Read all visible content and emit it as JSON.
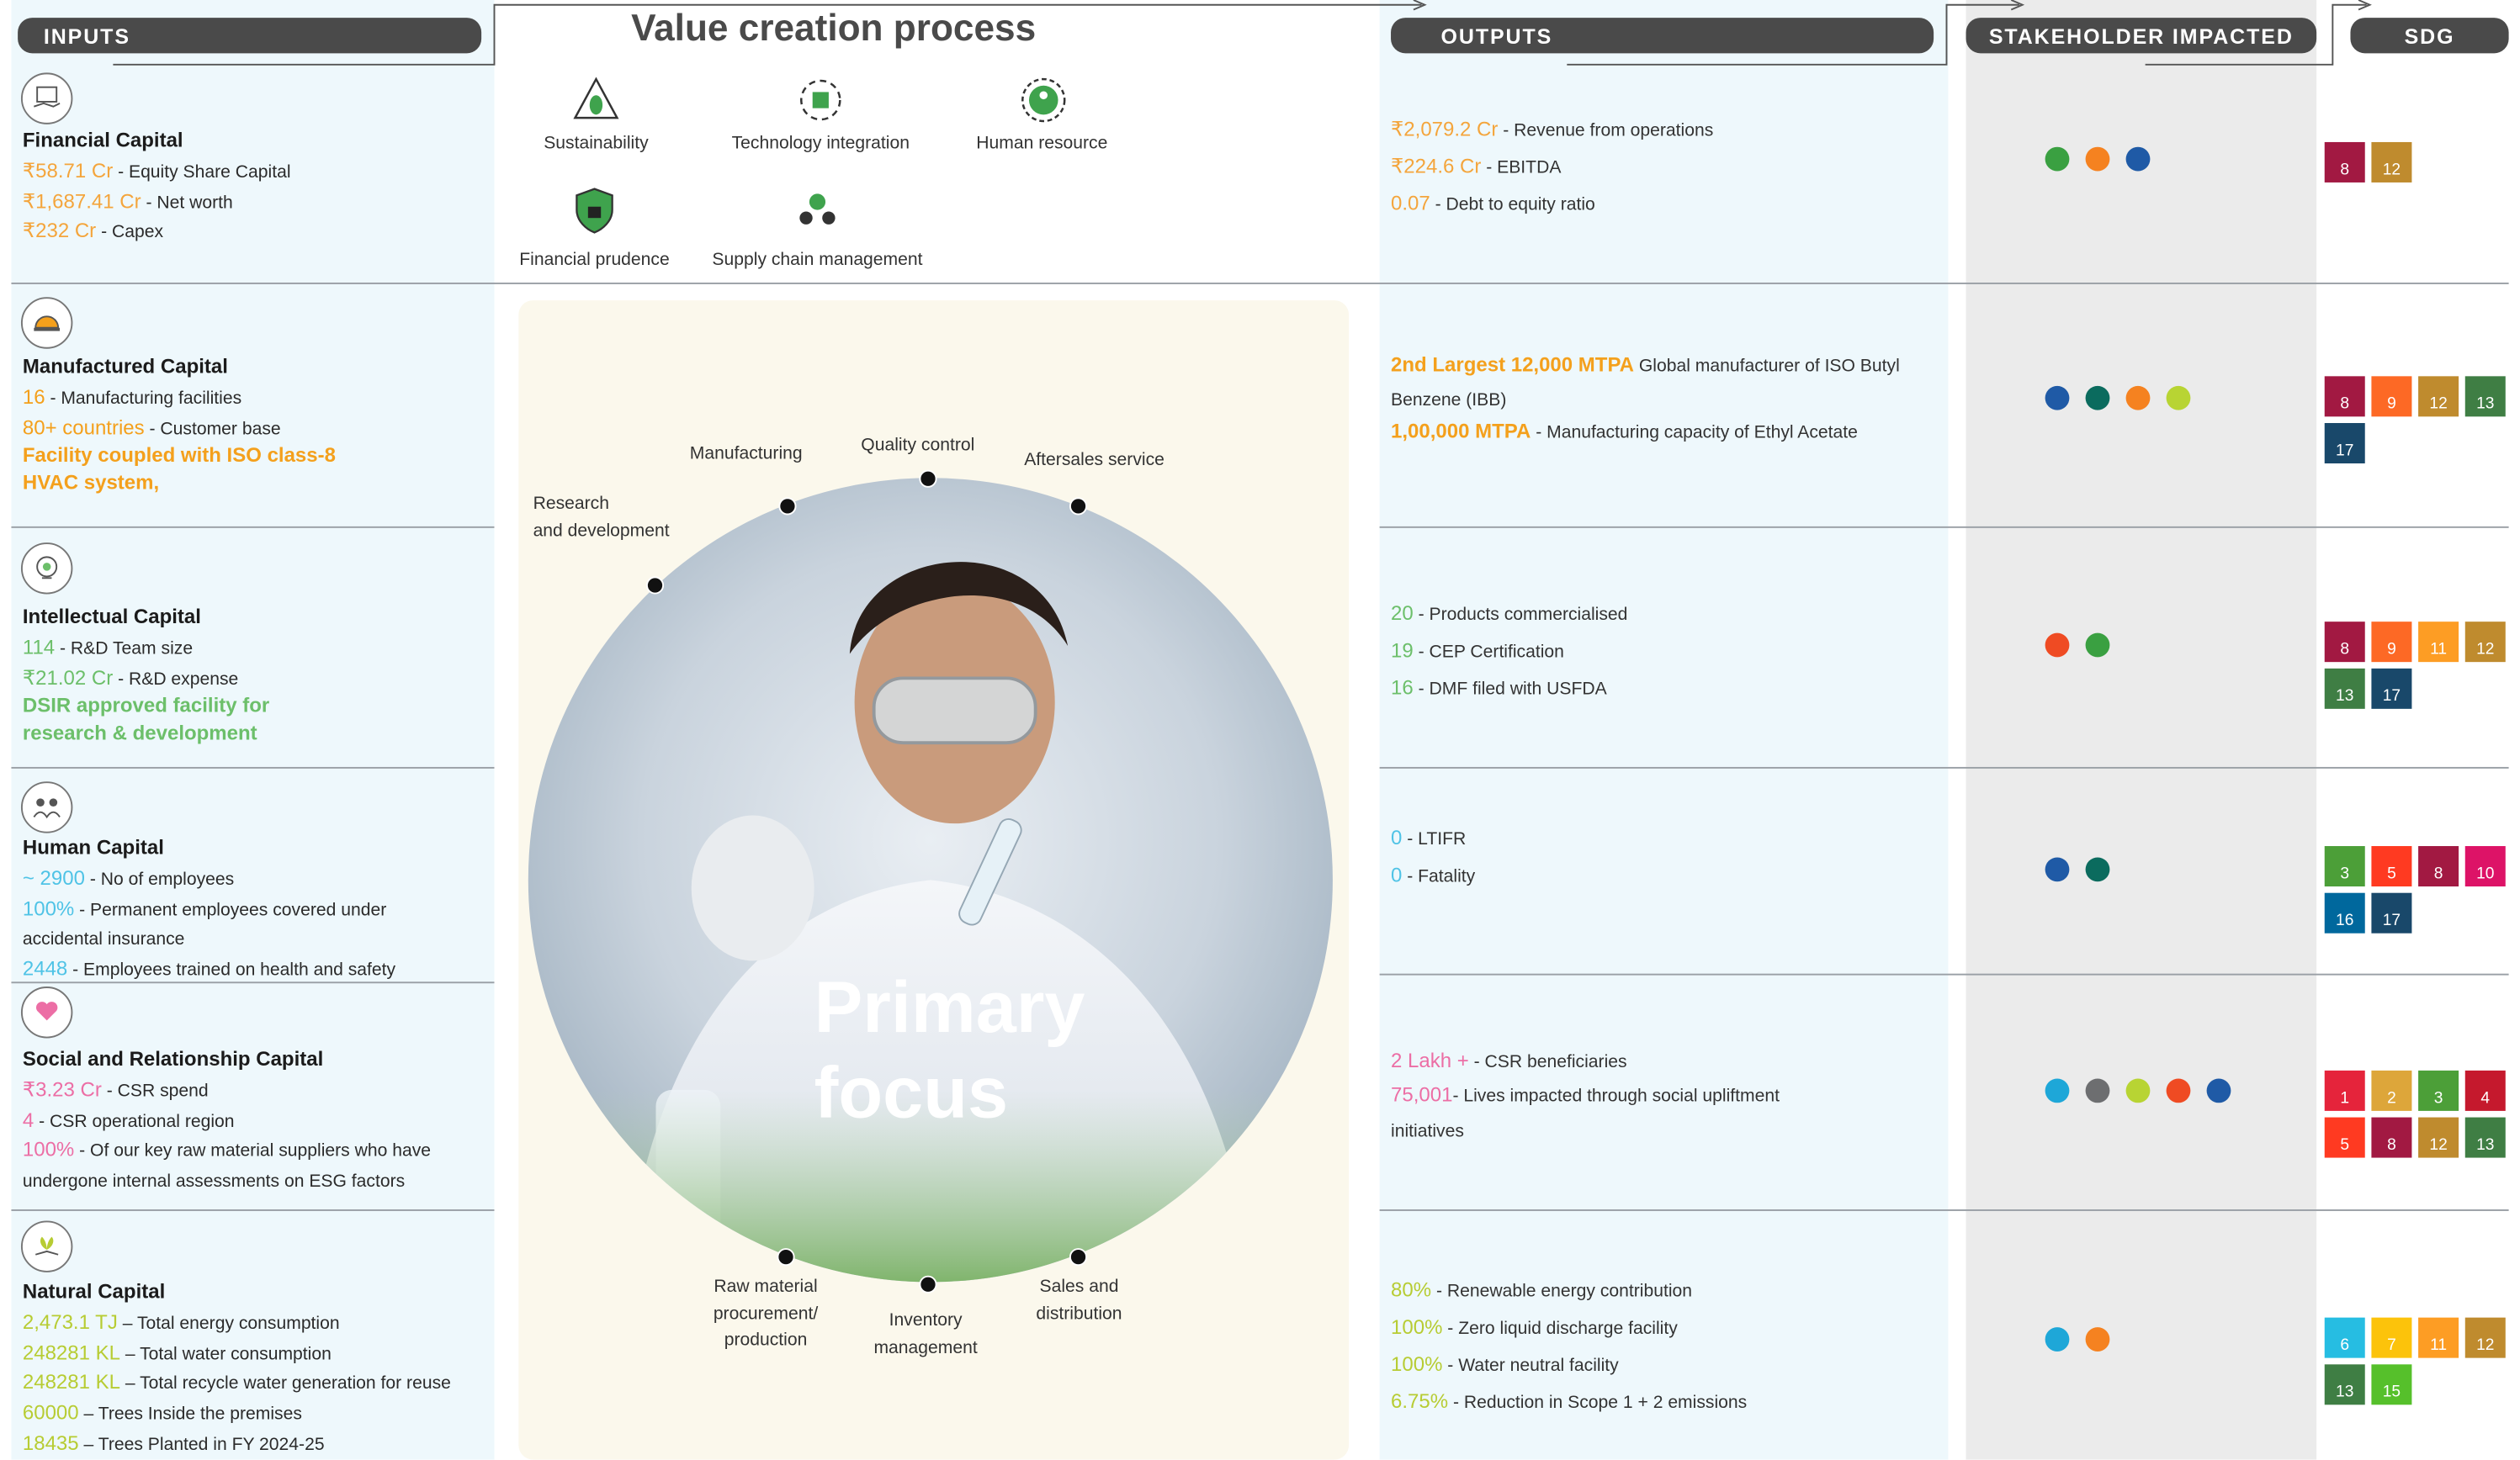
{
  "headers": {
    "inputs": "INPUTS",
    "value_title": "Value creation process",
    "outputs": "OUTPUTS",
    "stakeholder": "STAKEHOLDER IMPACTED",
    "sdg": "SDG"
  },
  "focus_areas": [
    {
      "label": "Sustainability",
      "icon": "recycle-leaf-icon"
    },
    {
      "label": "Technology integration",
      "icon": "network-icon"
    },
    {
      "label": "Human resource",
      "icon": "people-icon"
    },
    {
      "label": "Financial prudence",
      "icon": "shield-icon"
    },
    {
      "label": "Supply chain management",
      "icon": "supply-chain-icon"
    }
  ],
  "center": {
    "word1": "Primary",
    "word2": "focus",
    "stages": [
      "Research",
      "and development",
      "Manufacturing",
      "Quality control",
      "Aftersales service",
      "Raw material",
      "procurement/",
      "production",
      "Inventory",
      "management",
      "Sales and",
      "distribution"
    ]
  },
  "inputs": [
    {
      "title": "Financial Capital",
      "icon": "money-hand-icon",
      "rows": [
        {
          "v": "₹58.71 Cr",
          "d": " - Equity Share Capital"
        },
        {
          "v": "₹1,687.41 Cr",
          "d": " - Net worth"
        },
        {
          "v": "₹232 Cr",
          "d": " - Capex"
        }
      ]
    },
    {
      "title": "Manufactured Capital",
      "icon": "hard-hat-icon",
      "rows": [
        {
          "v": "16",
          "d": " - Manufacturing facilities"
        },
        {
          "v": "80+ countries",
          "d": " - Customer base"
        }
      ],
      "bold": [
        "Facility coupled with ISO class-8",
        "HVAC system,"
      ]
    },
    {
      "title": "Intellectual Capital",
      "icon": "head-bulb-icon",
      "rows": [
        {
          "v": "114",
          "d": " - R&D Team size"
        },
        {
          "v": "₹21.02 Cr",
          "d": " - R&D expense"
        }
      ],
      "bold": [
        "DSIR approved facility for",
        "research & development"
      ]
    },
    {
      "title": "Human Capital",
      "icon": "team-icon",
      "rows": [
        {
          "v": "~ 2900",
          "d": " - No of employees"
        },
        {
          "v": "100%",
          "d": " - Permanent employees covered under"
        },
        {
          "v": "",
          "d": "accidental insurance"
        },
        {
          "v": "2448",
          "d": " - Employees trained on health and safety"
        }
      ]
    },
    {
      "title": "Social and Relationship Capital",
      "icon": "heart-hands-icon",
      "rows": [
        {
          "v": "₹3.23 Cr",
          "d": " - CSR spend"
        },
        {
          "v": "4",
          "d": " - CSR operational region"
        },
        {
          "v": "100%",
          "d": " - Of our key raw material suppliers who have"
        },
        {
          "v": "",
          "d": "undergone internal  assessments on ESG factors"
        }
      ]
    },
    {
      "title": "Natural Capital",
      "icon": "plant-hand-icon",
      "rows": [
        {
          "v": "2,473.1 TJ",
          "d": " – Total energy consumption"
        },
        {
          "v": "248281 KL",
          "d": " – Total water consumption"
        },
        {
          "v": "248281 KL",
          "d": " – Total recycle water generation for reuse"
        },
        {
          "v": "60000",
          "d": " – Trees Inside the premises"
        },
        {
          "v": "18435",
          "d": " – Trees Planted in FY 2024-25"
        }
      ]
    }
  ],
  "outputs": [
    {
      "rows": [
        {
          "v": "₹2,079.2 Cr",
          "d": " - Revenue from operations"
        },
        {
          "v": "₹224.6 Cr",
          "d": " - EBITDA"
        },
        {
          "v": "0.07",
          "d": " - Debt to equity ratio"
        }
      ]
    },
    {
      "rows": [
        {
          "v": "2nd Largest 12,000 MTPA",
          "d": " Global manufacturer of ISO Butyl"
        },
        {
          "v": "",
          "d": "Benzene (IBB)"
        },
        {
          "v": "1,00,000 MTPA",
          "d": " - Manufacturing capacity of Ethyl Acetate"
        }
      ]
    },
    {
      "rows": [
        {
          "v": "20",
          "d": " - Products commercialised"
        },
        {
          "v": "19",
          "d": " - CEP Certification"
        },
        {
          "v": "16",
          "d": " - DMF filed with USFDA"
        }
      ]
    },
    {
      "rows": [
        {
          "v": "0",
          "d": " - LTIFR"
        },
        {
          "v": "0",
          "d": " - Fatality"
        }
      ]
    },
    {
      "rows": [
        {
          "v": "2 Lakh +",
          "d": " - CSR beneficiaries"
        },
        {
          "v": "75,001",
          "d": "- Lives impacted through social upliftment"
        },
        {
          "v": "",
          "d": "initiatives"
        }
      ]
    },
    {
      "rows": [
        {
          "v": "80%",
          "d": " - Renewable energy contribution"
        },
        {
          "v": "100%",
          "d": " - Zero liquid discharge facility"
        },
        {
          "v": "100%",
          "d": " - Water neutral facility"
        },
        {
          "v": "6.75%",
          "d": " - Reduction in Scope 1 + 2 emissions"
        }
      ]
    }
  ],
  "stakeholders": [
    [
      "#3aa041",
      "#f58220",
      "#1f5aa6"
    ],
    [
      "#1f5aa6",
      "#0b6b5e",
      "#f58220",
      "#b8d433"
    ],
    [
      "#ef4b23",
      "#3aa041"
    ],
    [
      "#1f5aa6",
      "#0b6b5e"
    ],
    [
      "#1ea7d8",
      "#6d6e70",
      "#b8d433",
      "#ef4b23",
      "#1f5aa6"
    ],
    [
      "#1ea7d8",
      "#f58220"
    ]
  ],
  "sdgs": [
    [
      "8",
      "12"
    ],
    [
      "8",
      "9",
      "12",
      "13",
      "17"
    ],
    [
      "8",
      "9",
      "11",
      "12",
      "13",
      "17"
    ],
    [
      "3",
      "5",
      "8",
      "10",
      "16",
      "17"
    ],
    [
      "1",
      "2",
      "3",
      "4",
      "5",
      "8",
      "12",
      "13"
    ],
    [
      "6",
      "7",
      "11",
      "12",
      "13",
      "15"
    ]
  ],
  "sdg_colors": {
    "1": "#e5243b",
    "2": "#dda63a",
    "3": "#4c9f38",
    "4": "#c5192d",
    "5": "#ff3a21",
    "6": "#26bde2",
    "7": "#fcc30b",
    "8": "#a21942",
    "9": "#fd6925",
    "10": "#dd1367",
    "11": "#fd9d24",
    "12": "#bf8b2e",
    "13": "#3f7e44",
    "15": "#56c02b",
    "16": "#00689d",
    "17": "#19486a"
  },
  "colors": {
    "financial": "#f4a53c",
    "manufactured": "#f4a01c",
    "intellectual": "#6cbf6a",
    "human": "#4fc3e6",
    "social": "#ec6ea5",
    "natural": "#b7cc33",
    "out_financial": "#f4a53c",
    "out_manufactured": "#f4a01c",
    "out_intellectual": "#6cbf6a",
    "out_human": "#4fc3e6",
    "out_social": "#ec6ea5",
    "out_natural": "#b7cc33"
  }
}
